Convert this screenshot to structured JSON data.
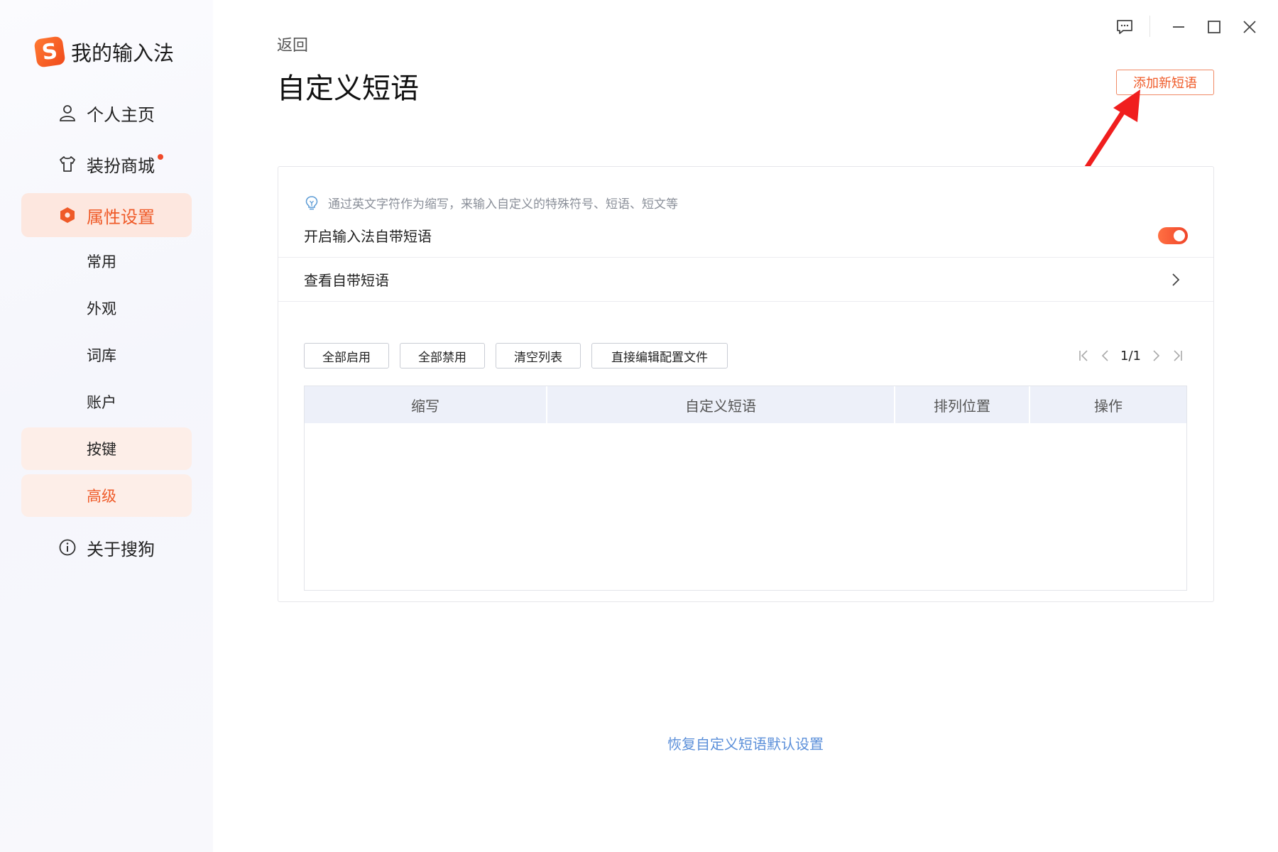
{
  "brand": {
    "logo_letter": "S",
    "name": "我的输入法"
  },
  "sidebar": {
    "items": [
      {
        "label": "个人主页",
        "icon": "person-icon"
      },
      {
        "label": "装扮商城",
        "icon": "shirt-icon",
        "has_dot": true
      },
      {
        "label": "属性设置",
        "icon": "hexagon-settings-icon",
        "active": true
      }
    ],
    "sub_items": [
      {
        "label": "常用"
      },
      {
        "label": "外观"
      },
      {
        "label": "词库"
      },
      {
        "label": "账户"
      },
      {
        "label": "按键"
      },
      {
        "label": "高级"
      }
    ],
    "about": {
      "label": "关于搜狗",
      "icon": "info-icon"
    }
  },
  "window": {
    "controls": [
      "feedback-icon",
      "minimize-icon",
      "maximize-icon",
      "close-icon"
    ]
  },
  "header": {
    "back": "返回",
    "title": "自定义短语",
    "add_button": "添加新短语"
  },
  "card": {
    "tip": "通过英文字符作为缩写，来输入自定义的特殊符号、短语、短文等",
    "enable_label": "开启输入法自带短语",
    "enable_on": true,
    "view_label": "查看自带短语",
    "toolbar": {
      "enable_all": "全部启用",
      "disable_all": "全部禁用",
      "clear_list": "清空列表",
      "edit_config": "直接编辑配置文件"
    },
    "pager": {
      "text": "1/1"
    },
    "table": {
      "columns": [
        "缩写",
        "自定义短语",
        "排列位置",
        "操作"
      ],
      "rows": []
    }
  },
  "footer": {
    "restore": "恢复自定义短语默认设置"
  },
  "colors": {
    "accent": "#ef5a28",
    "link": "#5b8fd9",
    "table_header": "#edf0f9",
    "annotation_arrow": "#f01e1e"
  }
}
